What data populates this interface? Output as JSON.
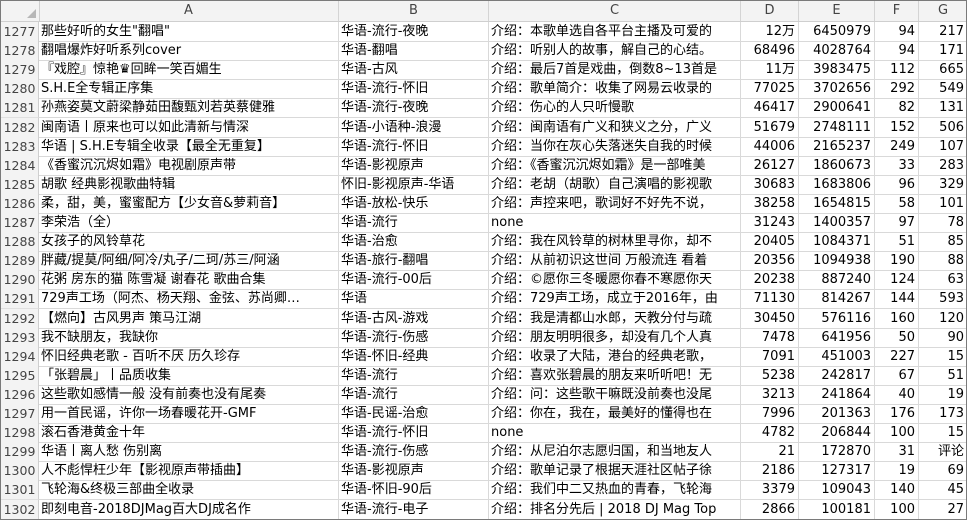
{
  "columns": [
    "A",
    "B",
    "C",
    "D",
    "E",
    "F",
    "G"
  ],
  "rows": [
    {
      "n": "1277",
      "a": "那些好听的女生\"翻唱\"",
      "b": "华语-流行-夜晚",
      "c": "介绍：本歌单选自各平台主播及可爱的",
      "d": "12万",
      "e": "6450979",
      "f": "94",
      "g": "217"
    },
    {
      "n": "1278",
      "a": "翻唱爆炸好听系列cover",
      "b": "华语-翻唱",
      "c": "介绍：听别人的故事，解自己的心结。",
      "d": "68496",
      "e": "4028764",
      "f": "94",
      "g": "171"
    },
    {
      "n": "1279",
      "a": "『戏腔』惊艳♛回眸一笑百媚生",
      "b": "华语-古风",
      "c": "介绍：最后7首是戏曲，倒数8~13首是",
      "d": "11万",
      "e": "3983475",
      "f": "112",
      "g": "665"
    },
    {
      "n": "1280",
      "a": "S.H.E全专辑正序集",
      "b": "华语-流行-怀旧",
      "c": "介绍：歌单简介：收集了网易云收录的",
      "d": "77025",
      "e": "3702656",
      "f": "292",
      "g": "549"
    },
    {
      "n": "1281",
      "a": "孙燕姿莫文蔚梁静茹田馥甄刘若英蔡健雅",
      "b": "华语-流行-夜晚",
      "c": "介绍：伤心的人只听慢歌",
      "d": "46417",
      "e": "2900641",
      "f": "82",
      "g": "131"
    },
    {
      "n": "1282",
      "a": "闽南语丨原来也可以如此清新与情深",
      "b": "华语-小语种-浪漫",
      "c": "介绍：闽南语有广义和狭义之分，广义",
      "d": "51679",
      "e": "2748111",
      "f": "152",
      "g": "506"
    },
    {
      "n": "1283",
      "a": "华语 | S.H.E专辑全收录【最全无重复】",
      "b": "华语-流行-怀旧",
      "c": "介绍：当你在灰心失落迷失自我的时候",
      "d": "44006",
      "e": "2165237",
      "f": "249",
      "g": "107"
    },
    {
      "n": "1284",
      "a": "《香蜜沉沉烬如霜》电视剧原声带",
      "b": "华语-影视原声",
      "c": "介绍：《香蜜沉沉烬如霜》是一部唯美",
      "d": "26127",
      "e": "1860673",
      "f": "33",
      "g": "283"
    },
    {
      "n": "1285",
      "a": "胡歌 经典影视歌曲特辑",
      "b": "怀旧-影视原声-华语",
      "c": "介绍：老胡（胡歌）自己演唱的影视歌",
      "d": "30683",
      "e": "1683806",
      "f": "96",
      "g": "329"
    },
    {
      "n": "1286",
      "a": "柔，甜，美，蜜蜜配方【少女音&萝莉音】",
      "b": "华语-放松-快乐",
      "c": "介绍：声控来吧，歌词好不好先不说，",
      "d": "38258",
      "e": "1654815",
      "f": "58",
      "g": "101"
    },
    {
      "n": "1287",
      "a": "李荣浩（全）",
      "b": "华语-流行",
      "c": "none",
      "d": "31243",
      "e": "1400357",
      "f": "97",
      "g": "78"
    },
    {
      "n": "1288",
      "a": "女孩子的风铃草花",
      "b": "华语-治愈",
      "c": "介绍：我在风铃草的树林里寻你，却不",
      "d": "20405",
      "e": "1084371",
      "f": "51",
      "g": "85"
    },
    {
      "n": "1289",
      "a": "胖藏/提莫/阿细/阿冷/丸子/二珂/苏三/阿涵",
      "b": "华语-旅行-翻唱",
      "c": "介绍：从前初识这世间 万般流连 看着",
      "d": "20356",
      "e": "1094938",
      "f": "190",
      "g": "88"
    },
    {
      "n": "1290",
      "a": "花粥 房东的猫 陈雪凝 谢春花 歌曲合集",
      "b": "华语-流行-00后",
      "c": "介绍：©愿你三冬暖愿你春不寒愿你天",
      "d": "20238",
      "e": "887240",
      "f": "124",
      "g": "63"
    },
    {
      "n": "1291",
      "a": "729声工场（阿杰、杨天翔、金弦、苏尚卿…",
      "b": "华语",
      "c": "介绍：729声工场，成立于2016年，由",
      "d": "71130",
      "e": "814267",
      "f": "144",
      "g": "593"
    },
    {
      "n": "1292",
      "a": "【燃向】古风男声 策马江湖",
      "b": "华语-古风-游戏",
      "c": "介绍：我是清都山水郎，天教分付与疏",
      "d": "30450",
      "e": "576116",
      "f": "160",
      "g": "120"
    },
    {
      "n": "1293",
      "a": "我不缺朋友，我缺你",
      "b": "华语-流行-伤感",
      "c": "介绍：朋友明明很多，却没有几个人真",
      "d": "7478",
      "e": "641956",
      "f": "50",
      "g": "90"
    },
    {
      "n": "1294",
      "a": "怀旧经典老歌 - 百听不厌 历久珍存",
      "b": "华语-怀旧-经典",
      "c": "介绍：收录了大陆，港台的经典老歌，",
      "d": "7091",
      "e": "451003",
      "f": "227",
      "g": "15"
    },
    {
      "n": "1295",
      "a": "「张碧晨」丨品质收集",
      "b": "华语-流行",
      "c": "介绍：喜欢张碧晨的朋友来听听吧！无",
      "d": "5238",
      "e": "242817",
      "f": "67",
      "g": "51"
    },
    {
      "n": "1296",
      "a": "这些歌如感情一般 没有前奏也没有尾奏",
      "b": "华语-流行",
      "c": "介绍：问：这些歌干嘛既没前奏也没尾",
      "d": "3213",
      "e": "241864",
      "f": "40",
      "g": "19"
    },
    {
      "n": "1297",
      "a": "用一首民谣，许你一场春暖花开-GMF",
      "b": "华语-民谣-治愈",
      "c": "介绍：你在，我在，最美好的懂得也在",
      "d": "7996",
      "e": "201363",
      "f": "176",
      "g": "173"
    },
    {
      "n": "1298",
      "a": "滚石香港黄金十年",
      "b": "华语-流行-怀旧",
      "c": "none",
      "d": "4782",
      "e": "206844",
      "f": "100",
      "g": "15"
    },
    {
      "n": "1299",
      "a": "华语丨离人愁 伤别离",
      "b": "华语-流行-伤感",
      "c": "介绍：从尼泊尔志愿归国，和当地友人",
      "d": "21",
      "e": "172870",
      "f": "31",
      "g": "评论"
    },
    {
      "n": "1300",
      "a": "人不彪悍枉少年【影视原声带插曲】",
      "b": "华语-影视原声",
      "c": "介绍：歌单记录了根据天涯社区帖子徐",
      "d": "2186",
      "e": "127317",
      "f": "19",
      "g": "69"
    },
    {
      "n": "1301",
      "a": "飞轮海&终极三部曲全收录",
      "b": "华语-怀旧-90后",
      "c": "介绍：我们中二又热血的青春，飞轮海",
      "d": "3379",
      "e": "109043",
      "f": "140",
      "g": "45"
    },
    {
      "n": "1302",
      "a": "即刻电音-2018DJMag百大DJ成名作",
      "b": "华语-流行-电子",
      "c": "介绍：排名分先后 | 2018 DJ Mag Top",
      "d": "2866",
      "e": "100181",
      "f": "100",
      "g": "27"
    }
  ]
}
